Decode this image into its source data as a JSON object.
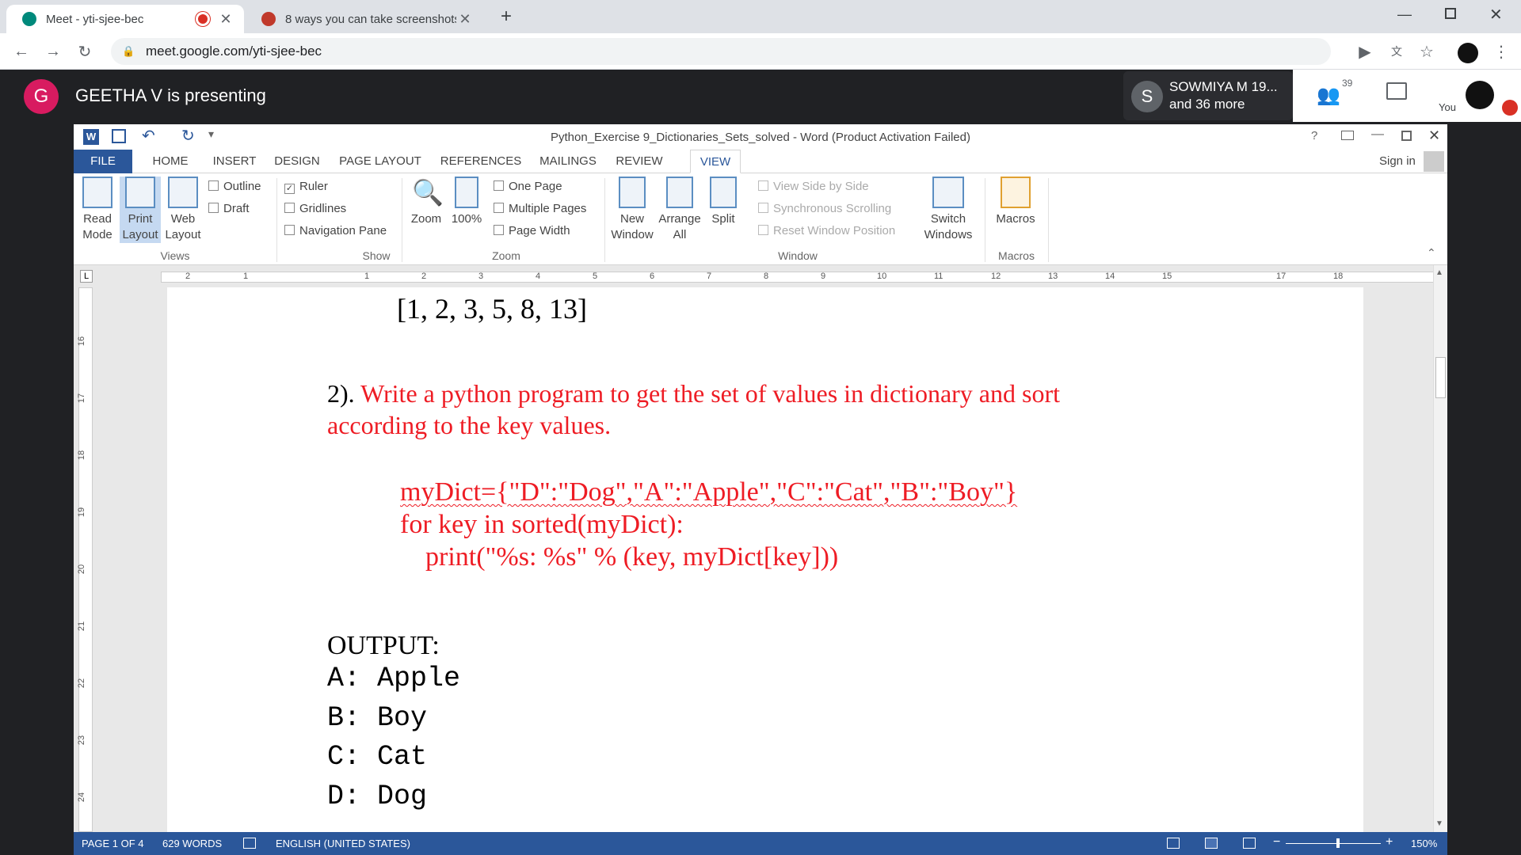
{
  "browser": {
    "tabs": [
      {
        "title": "Meet - yti-sjee-bec",
        "active": true
      },
      {
        "title": "8 ways you can take screenshots",
        "active": false
      }
    ],
    "url": "meet.google.com/yti-sjee-bec"
  },
  "meet": {
    "presenter_initial": "G",
    "presenting_text": "GEETHA V is presenting",
    "participant_initial": "S",
    "participant_name": "SOWMIYA M 19...",
    "participant_more": "and 36 more",
    "people_count": "39",
    "you_label": "You"
  },
  "word": {
    "title": "Python_Exercise 9_Dictionaries_Sets_solved - Word (Product Activation Failed)",
    "sign_in": "Sign in",
    "ribbon_tabs": [
      "FILE",
      "HOME",
      "INSERT",
      "DESIGN",
      "PAGE LAYOUT",
      "REFERENCES",
      "MAILINGS",
      "REVIEW",
      "VIEW"
    ],
    "active_tab": "VIEW",
    "groups": {
      "views": {
        "label": "Views",
        "read_mode": "Read Mode",
        "print_layout": "Print Layout",
        "web_layout": "Web Layout",
        "outline": "Outline",
        "draft": "Draft"
      },
      "show": {
        "label": "Show",
        "ruler": "Ruler",
        "gridlines": "Gridlines",
        "navigation_pane": "Navigation Pane"
      },
      "zoom": {
        "label": "Zoom",
        "zoom": "Zoom",
        "hundred": "100%",
        "one_page": "One Page",
        "multiple_pages": "Multiple Pages",
        "page_width": "Page Width"
      },
      "window": {
        "label": "Window",
        "new_window": "New Window",
        "arrange_all": "Arrange All",
        "split": "Split",
        "view_side": "View Side by Side",
        "sync_scroll": "Synchronous Scrolling",
        "reset_pos": "Reset Window Position",
        "switch_windows": "Switch Windows"
      },
      "macros": {
        "label": "Macros",
        "macros": "Macros"
      }
    },
    "ruler_numbers": [
      "2",
      "1",
      "1",
      "2",
      "3",
      "4",
      "5",
      "6",
      "7",
      "8",
      "9",
      "10",
      "11",
      "12",
      "13",
      "14",
      "15",
      "17",
      "18"
    ],
    "vruler_numbers": [
      "16",
      "17",
      "18",
      "19",
      "20",
      "21",
      "22",
      "23",
      "24"
    ],
    "document": {
      "list_line": "[1, 2, 3, 5, 8, 13]",
      "q_num": "2). ",
      "q_line1": "Write a python program to get the set of values in dictionary and sort",
      "q_line2": "according to the key values.",
      "code1": "myDict={\"D\":\"Dog\",\"A\":\"Apple\",\"C\":\"Cat\",\"B\":\"Boy\"}",
      "code2": "for key in sorted(myDict):",
      "code3": "print(\"%s: %s\" % (key, myDict[key]))",
      "output_label": "OUTPUT:",
      "output_lines": [
        "A: Apple",
        "B: Boy",
        "C: Cat",
        "D: Dog"
      ]
    },
    "status": {
      "page": "PAGE 1 OF 4",
      "words": "629 WORDS",
      "language": "ENGLISH (UNITED STATES)",
      "zoom": "150%"
    }
  }
}
